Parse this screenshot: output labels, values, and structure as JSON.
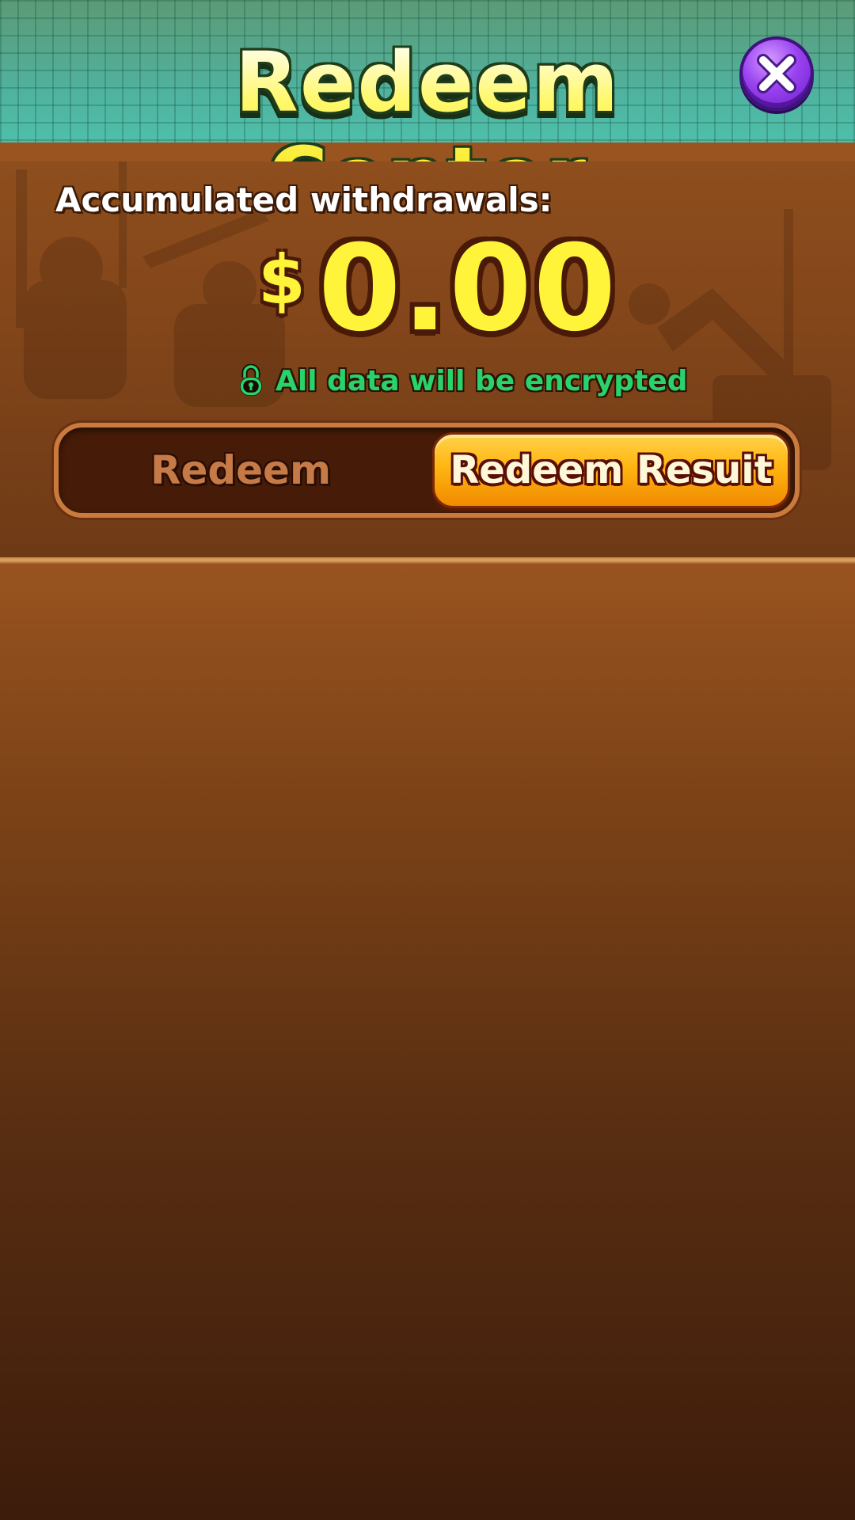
{
  "header": {
    "title": "Redeem Center",
    "close_icon": "close-icon"
  },
  "summary": {
    "accumulated_label": "Accumulated withdrawals:",
    "currency_symbol": "$",
    "amount": "0.00",
    "encryption_notice": "All data will be encrypted",
    "lock_icon": "lock-icon"
  },
  "tabs": [
    {
      "label": "Redeem",
      "active": false
    },
    {
      "label": "Redeem Resuit",
      "active": true
    }
  ],
  "colors": {
    "header_teal": "#48b99f",
    "title_yellow": "#fdf53a",
    "panel_brown": "#8e4e1d",
    "active_tab_orange": "#ffb612",
    "encrypt_green": "#28d36a",
    "close_purple": "#9a43f0"
  }
}
